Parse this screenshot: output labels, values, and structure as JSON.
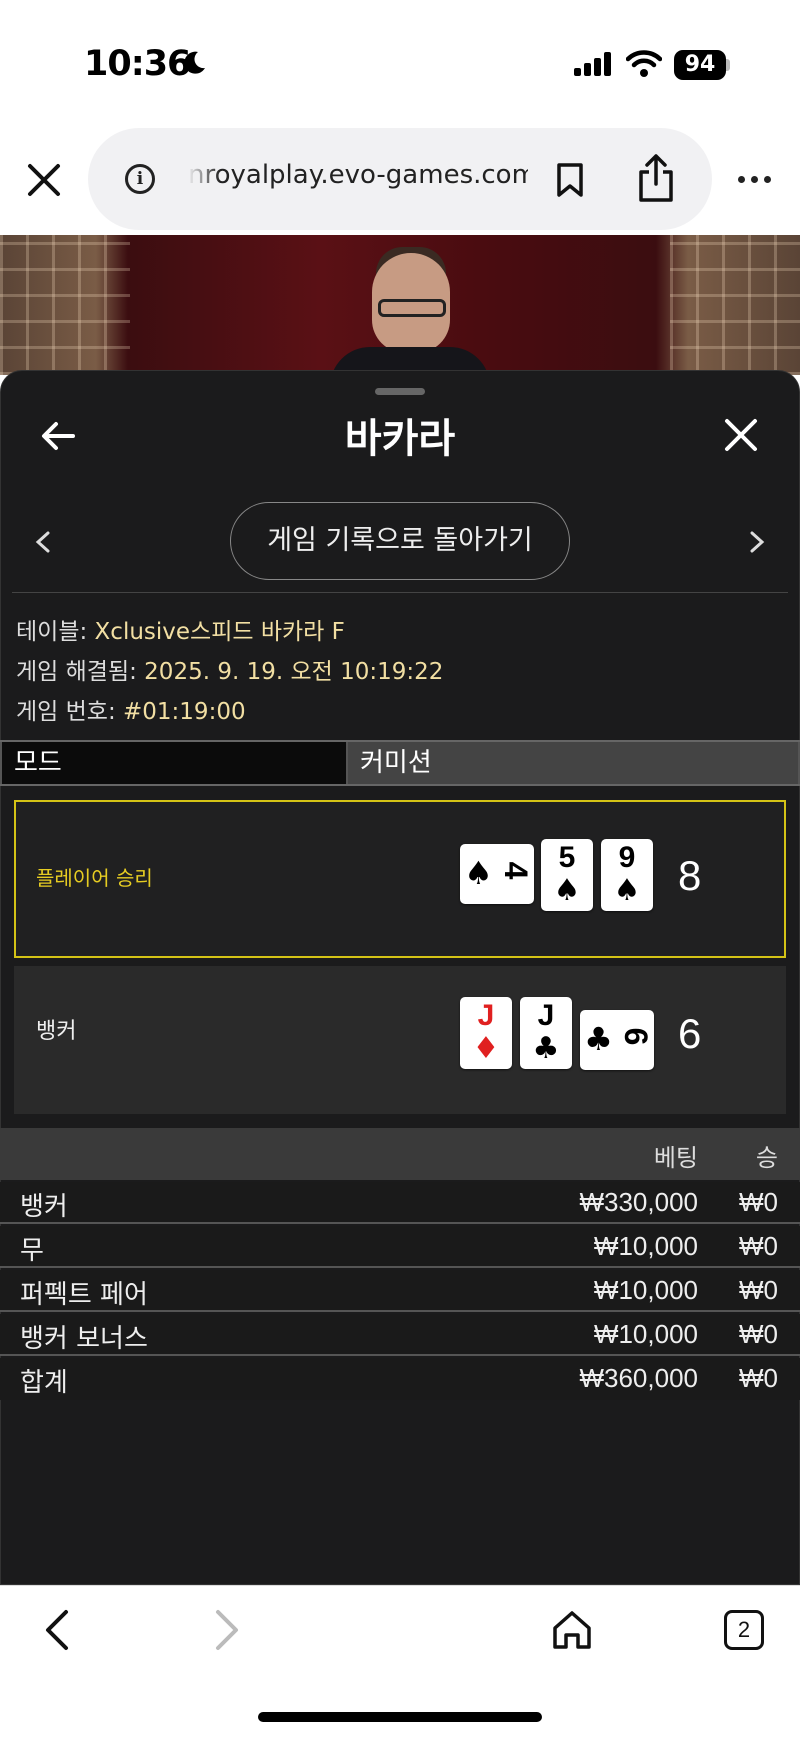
{
  "status": {
    "time": "10:36",
    "battery": "94"
  },
  "browser": {
    "url": "nroyalplay.evo-games.com",
    "tab_count": "2"
  },
  "panel": {
    "title": "바카라",
    "history_button": "게임 기록으로 돌아가기"
  },
  "game_info": {
    "table_label": "테이블: ",
    "table_value": "Xclusive스피드 바카라 F",
    "resolved_label": "게임 해결됨: ",
    "resolved_value": "2025. 9. 19. 오전 10:19:22",
    "number_label": "게임 번호: ",
    "number_value": "#01:19:00"
  },
  "mode": {
    "mode_label": "모드",
    "commission_label": "커미션"
  },
  "hands": {
    "player": {
      "label": "플레이어 승리",
      "score": "8",
      "cards": [
        {
          "rank": "4",
          "suit": "♠",
          "color": "#000000",
          "rotated": true
        },
        {
          "rank": "5",
          "suit": "♠",
          "color": "#000000",
          "rotated": false
        },
        {
          "rank": "9",
          "suit": "♠",
          "color": "#000000",
          "rotated": false
        }
      ]
    },
    "banker": {
      "label": "뱅커",
      "score": "6",
      "cards": [
        {
          "rank": "J",
          "suit": "♦",
          "color": "#e02020",
          "rotated": false
        },
        {
          "rank": "J",
          "suit": "♣",
          "color": "#000000",
          "rotated": false
        },
        {
          "rank": "6",
          "suit": "♣",
          "color": "#000000",
          "rotated": true
        }
      ]
    }
  },
  "bets": {
    "header_bet": "베팅",
    "header_win": "승",
    "rows": [
      {
        "name": "뱅커",
        "amount": "₩330,000",
        "win": "₩0"
      },
      {
        "name": "무",
        "amount": "₩10,000",
        "win": "₩0"
      },
      {
        "name": "퍼펙트 페어",
        "amount": "₩10,000",
        "win": "₩0"
      },
      {
        "name": "뱅커 보너스",
        "amount": "₩10,000",
        "win": "₩0"
      }
    ],
    "total": {
      "name": "합계",
      "amount": "₩360,000",
      "win": "₩0"
    }
  },
  "colors": {
    "accent": "#d4c316",
    "panel_bg": "#1b1b1c",
    "info_value": "#f2dfa3"
  }
}
